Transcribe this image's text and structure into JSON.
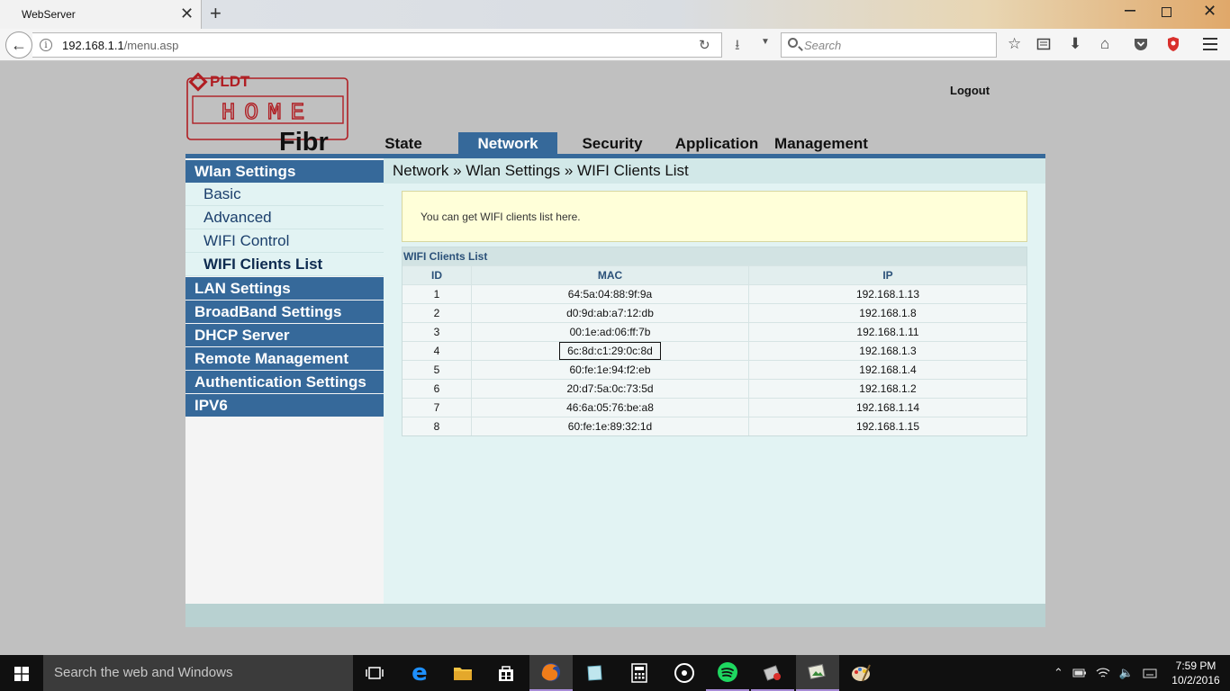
{
  "browser": {
    "tab_title": "WebServer",
    "url_host": "192.168.1.1",
    "url_path": "/menu.asp",
    "search_placeholder": "Search"
  },
  "header": {
    "logo_top": "PLDT",
    "logo_mid": "HOME",
    "logo_bottom": "Fibr",
    "logout": "Logout",
    "tabs": [
      "State",
      "Network",
      "Security",
      "Application",
      "Management"
    ],
    "active_tab": "Network"
  },
  "sidebar": {
    "wlan_title": "Wlan Settings",
    "wlan_items": [
      "Basic",
      "Advanced",
      "WIFI Control",
      "WIFI Clients List"
    ],
    "active_item": "WIFI Clients List",
    "sections": [
      "LAN Settings",
      "BroadBand Settings",
      "DHCP Server",
      "Remote Management",
      "Authentication Settings",
      "IPV6"
    ]
  },
  "content": {
    "breadcrumb": "Network » Wlan Settings » WIFI Clients List",
    "notice": "You can get WIFI clients list here.",
    "table_title": "WIFI Clients List",
    "columns": [
      "ID",
      "MAC",
      "IP"
    ],
    "rows": [
      {
        "id": "1",
        "mac": "64:5a:04:88:9f:9a",
        "ip": "192.168.1.13"
      },
      {
        "id": "2",
        "mac": "d0:9d:ab:a7:12:db",
        "ip": "192.168.1.8"
      },
      {
        "id": "3",
        "mac": "00:1e:ad:06:ff:7b",
        "ip": "192.168.1.11"
      },
      {
        "id": "4",
        "mac": "6c:8d:c1:29:0c:8d",
        "ip": "192.168.1.3"
      },
      {
        "id": "5",
        "mac": "60:fe:1e:94:f2:eb",
        "ip": "192.168.1.4"
      },
      {
        "id": "6",
        "mac": "20:d7:5a:0c:73:5d",
        "ip": "192.168.1.2"
      },
      {
        "id": "7",
        "mac": "46:6a:05:76:be:a8",
        "ip": "192.168.1.14"
      },
      {
        "id": "8",
        "mac": "60:fe:1e:89:32:1d",
        "ip": "192.168.1.15"
      }
    ]
  },
  "taskbar": {
    "search_text": "Search the web and Windows",
    "time": "7:59 PM",
    "date": "10/2/2016"
  },
  "colors": {
    "brand_blue": "#36699a",
    "logo_red": "#b01e23"
  }
}
